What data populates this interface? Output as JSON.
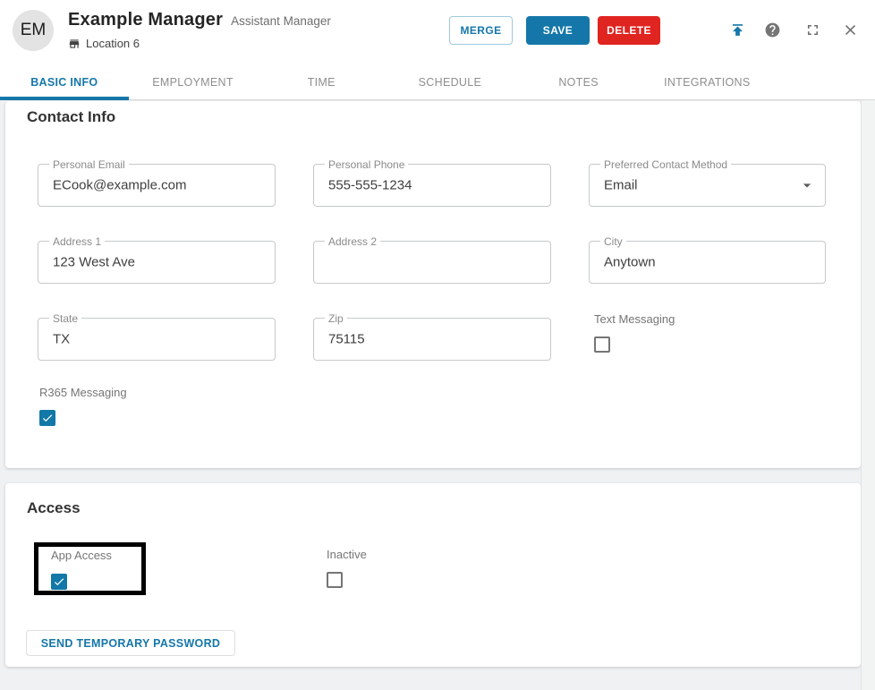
{
  "colors": {
    "primary": "#1577a9",
    "danger": "#e02420",
    "checkbox_checked": "#1178a8",
    "merge_border": "#9fc9de",
    "tab_inactive": "#8e8e8e",
    "page_bg": "#f0f1f2",
    "highlight_border": "#000000"
  },
  "header": {
    "avatar_initials": "EM",
    "title": "Example Manager",
    "subtitle": "Assistant Manager",
    "location": "Location 6",
    "buttons": {
      "merge": "MERGE",
      "save": "SAVE",
      "delete": "DELETE"
    },
    "icons": {
      "location": "store-icon",
      "upload": "upload-icon",
      "help": "help-icon",
      "fullscreen": "fullscreen-icon",
      "close": "close-icon"
    }
  },
  "tabs": [
    {
      "label": "BASIC INFO",
      "active": true
    },
    {
      "label": "EMPLOYMENT",
      "active": false
    },
    {
      "label": "TIME",
      "active": false
    },
    {
      "label": "SCHEDULE",
      "active": false
    },
    {
      "label": "NOTES",
      "active": false
    },
    {
      "label": "INTEGRATIONS",
      "active": false
    }
  ],
  "contact_info": {
    "heading": "Contact Info",
    "fields": {
      "personal_email": {
        "label": "Personal Email",
        "value": "ECook@example.com"
      },
      "personal_phone": {
        "label": "Personal Phone",
        "value": "555-555-1234"
      },
      "preferred_contact_method": {
        "label": "Preferred Contact Method",
        "value": "Email"
      },
      "address_1": {
        "label": "Address 1",
        "value": "123 West Ave"
      },
      "address_2": {
        "label": "Address 2",
        "value": ""
      },
      "city": {
        "label": "City",
        "value": "Anytown"
      },
      "state": {
        "label": "State",
        "value": "TX"
      },
      "zip": {
        "label": "Zip",
        "value": "75115"
      }
    },
    "checkboxes": {
      "text_messaging": {
        "label": "Text Messaging",
        "checked": false
      },
      "r365_messaging": {
        "label": "R365 Messaging",
        "checked": true
      }
    }
  },
  "access": {
    "heading": "Access",
    "checkboxes": {
      "app_access": {
        "label": "App Access",
        "checked": true,
        "highlighted": true
      },
      "inactive": {
        "label": "Inactive",
        "checked": false
      }
    },
    "send_password_button": "SEND TEMPORARY PASSWORD"
  }
}
